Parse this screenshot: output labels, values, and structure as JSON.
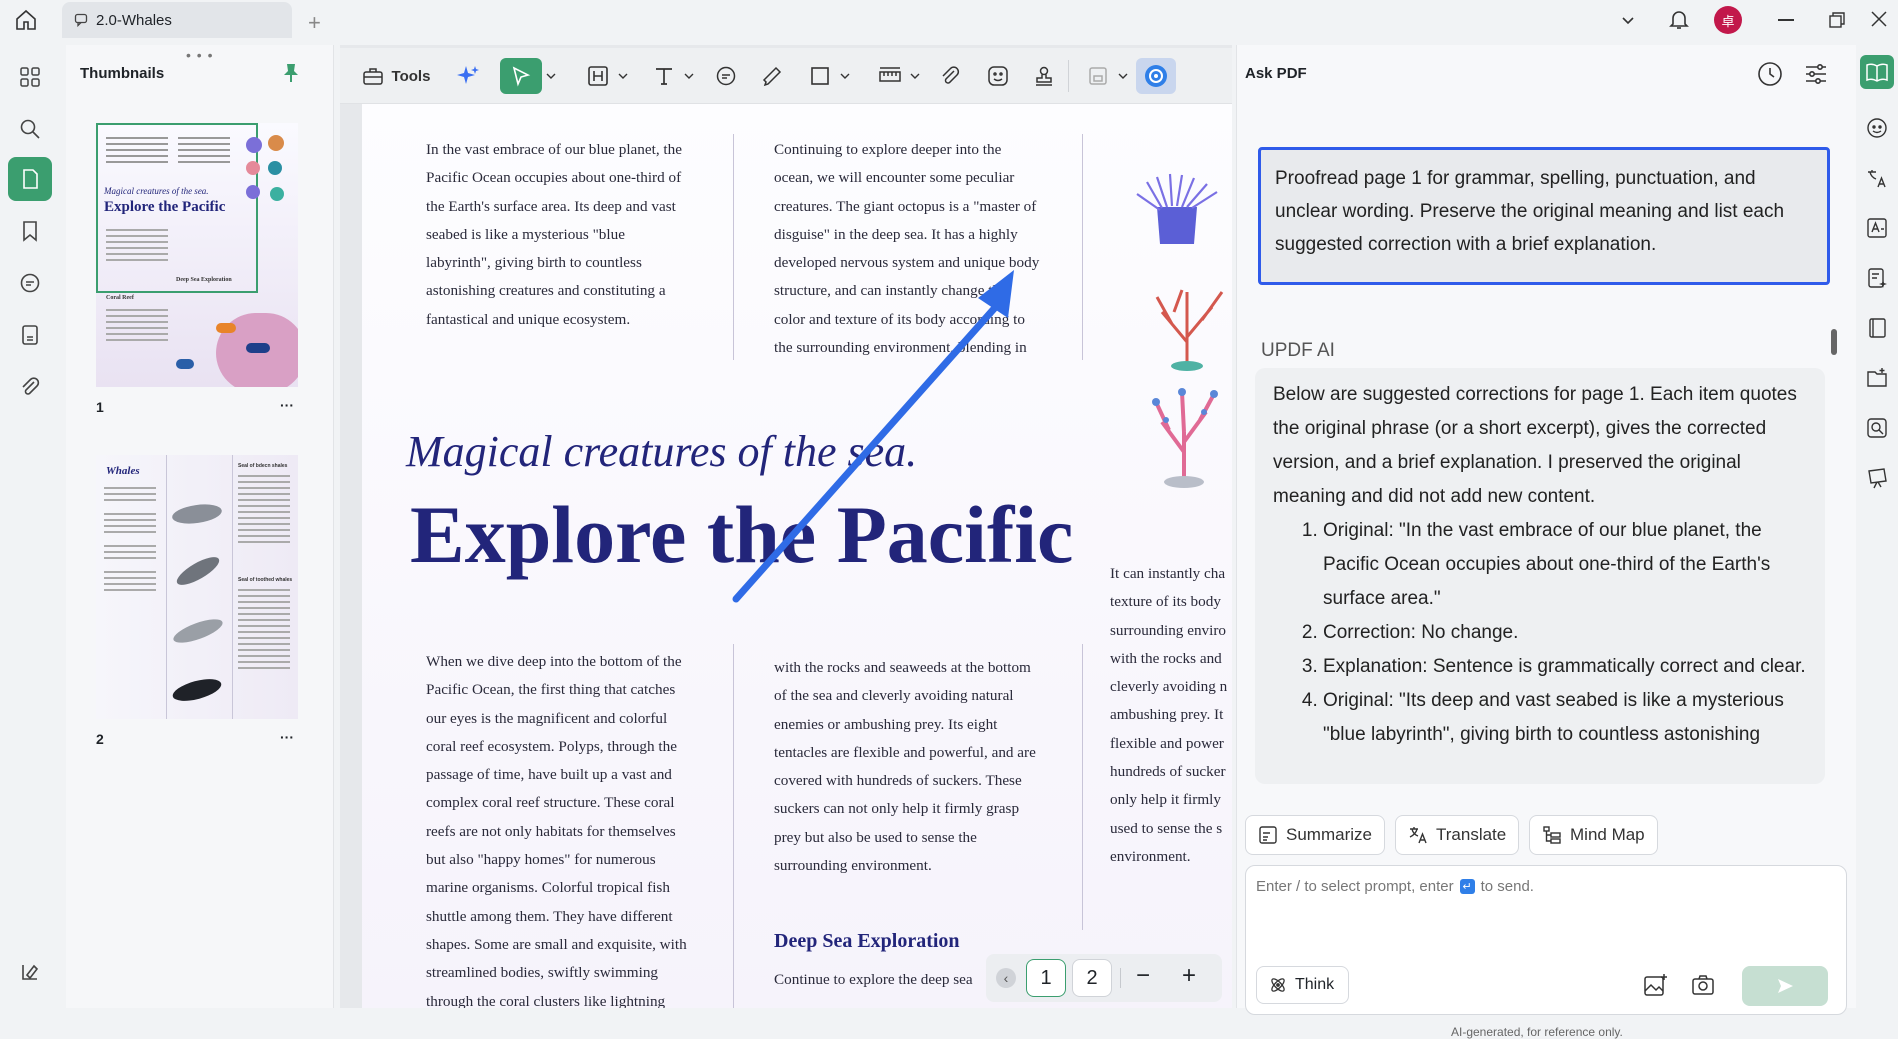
{
  "titlebar": {
    "tab_title": "2.0-Whales",
    "avatar_initial": "卓"
  },
  "thumbnails": {
    "title": "Thumbnails",
    "pages": [
      {
        "num": "1",
        "more": "···"
      },
      {
        "num": "2",
        "more": "···"
      }
    ],
    "thumb1": {
      "subtitle": "Magical creatures of the sea.",
      "title": "Explore the Pacific",
      "section": "Coral Reef",
      "section2": "Deep Sea Exploration"
    },
    "thumb2": {
      "title": "Whales",
      "h1": "Seal of bdecn shales",
      "h2": "Seal of toothed whales"
    }
  },
  "toolbar": {
    "tools_label": "Tools"
  },
  "document": {
    "col1_top": [
      "In the vast embrace of our blue planet, the",
      "Pacific Ocean occupies about one-third of",
      "the Earth's surface area. Its deep and vast",
      "seabed is like a mysterious \"blue",
      "labyrinth\", giving birth to countless",
      "astonishing creatures and constituting a",
      "fantastical and unique ecosystem."
    ],
    "col2_top": [
      "Continuing to explore deeper into the",
      "ocean, we will encounter some peculiar",
      "creatures. The giant octopus is a \"master of",
      "disguise\" in the deep sea. It has a highly",
      "developed nervous system and unique body",
      "structure, and can instantly change the",
      "color and texture of its body according to",
      "the surrounding environment, blending in"
    ],
    "subtitle": "Magical creatures of the sea.",
    "title": "Explore the Pacific",
    "col3": [
      "It can instantly cha",
      "texture of its body",
      "surrounding enviro",
      "with the rocks and",
      "cleverly avoiding n",
      "ambushing prey. It",
      "flexible and power",
      "hundreds of sucker",
      "only help it firmly",
      "used to sense the s",
      "environment."
    ],
    "col1_bottom": [
      "When we dive deep into the bottom of the",
      "Pacific Ocean, the first thing that catches",
      "our eyes is the magnificent and colorful",
      "coral reef ecosystem. Polyps, through the",
      "passage of time, have built up a vast and",
      "complex coral reef structure. These coral",
      "reefs are not only habitats for themselves",
      "but also \"happy homes\" for numerous",
      "marine organisms. Colorful tropical fish",
      "shuttle among them. They have different",
      "shapes. Some are small and exquisite, with",
      "streamlined bodies, swiftly swimming",
      "through the coral clusters like lightning"
    ],
    "col2_bottom": [
      "with the rocks and seaweeds at the bottom",
      "of the sea and cleverly avoiding natural",
      "enemies or ambushing prey. Its eight",
      "tentacles are flexible and powerful, and are",
      "covered with hundreds of suckers. These",
      "suckers can not only help it firmly grasp",
      "prey but also be used to sense the",
      "surrounding environment."
    ],
    "deep_sea_heading": "Deep Sea Exploration",
    "deep_sea_line": "Continue to explore the deep sea"
  },
  "pagenav": {
    "pages": [
      "1",
      "2"
    ],
    "minus": "−",
    "plus": "+"
  },
  "ask": {
    "title": "Ask PDF",
    "prompt": "Proofread page 1 for grammar, spelling, punctuation, and unclear wording. Preserve the original meaning and list each suggested correction with a brief explanation.",
    "ai_label": "UPDF AI",
    "response_intro": "Below are suggested corrections for page 1. Each item quotes the original phrase (or a short excerpt), gives the corrected version, and a brief explanation. I preserved the original meaning and did not add new content.",
    "items": [
      "Original: \"In the vast embrace of our blue planet, the Pacific Ocean occupies about one-third of the Earth's surface area.\"",
      "Correction: No change.",
      "Explanation: Sentence is grammatically correct and clear.",
      "Original: \"Its deep and vast seabed is like a mysterious \"blue labyrinth\", giving birth to countless astonishing"
    ],
    "chips": [
      "Summarize",
      "Translate",
      "Mind Map"
    ],
    "input_placeholder_a": "Enter / to select prompt, enter",
    "input_placeholder_b": "to send.",
    "think_label": "Think",
    "footer": "AI-generated, for reference only."
  },
  "colors": {
    "accent": "#3b9e6f",
    "prompt_border": "#2f5bea",
    "title_navy": "#22257a"
  }
}
